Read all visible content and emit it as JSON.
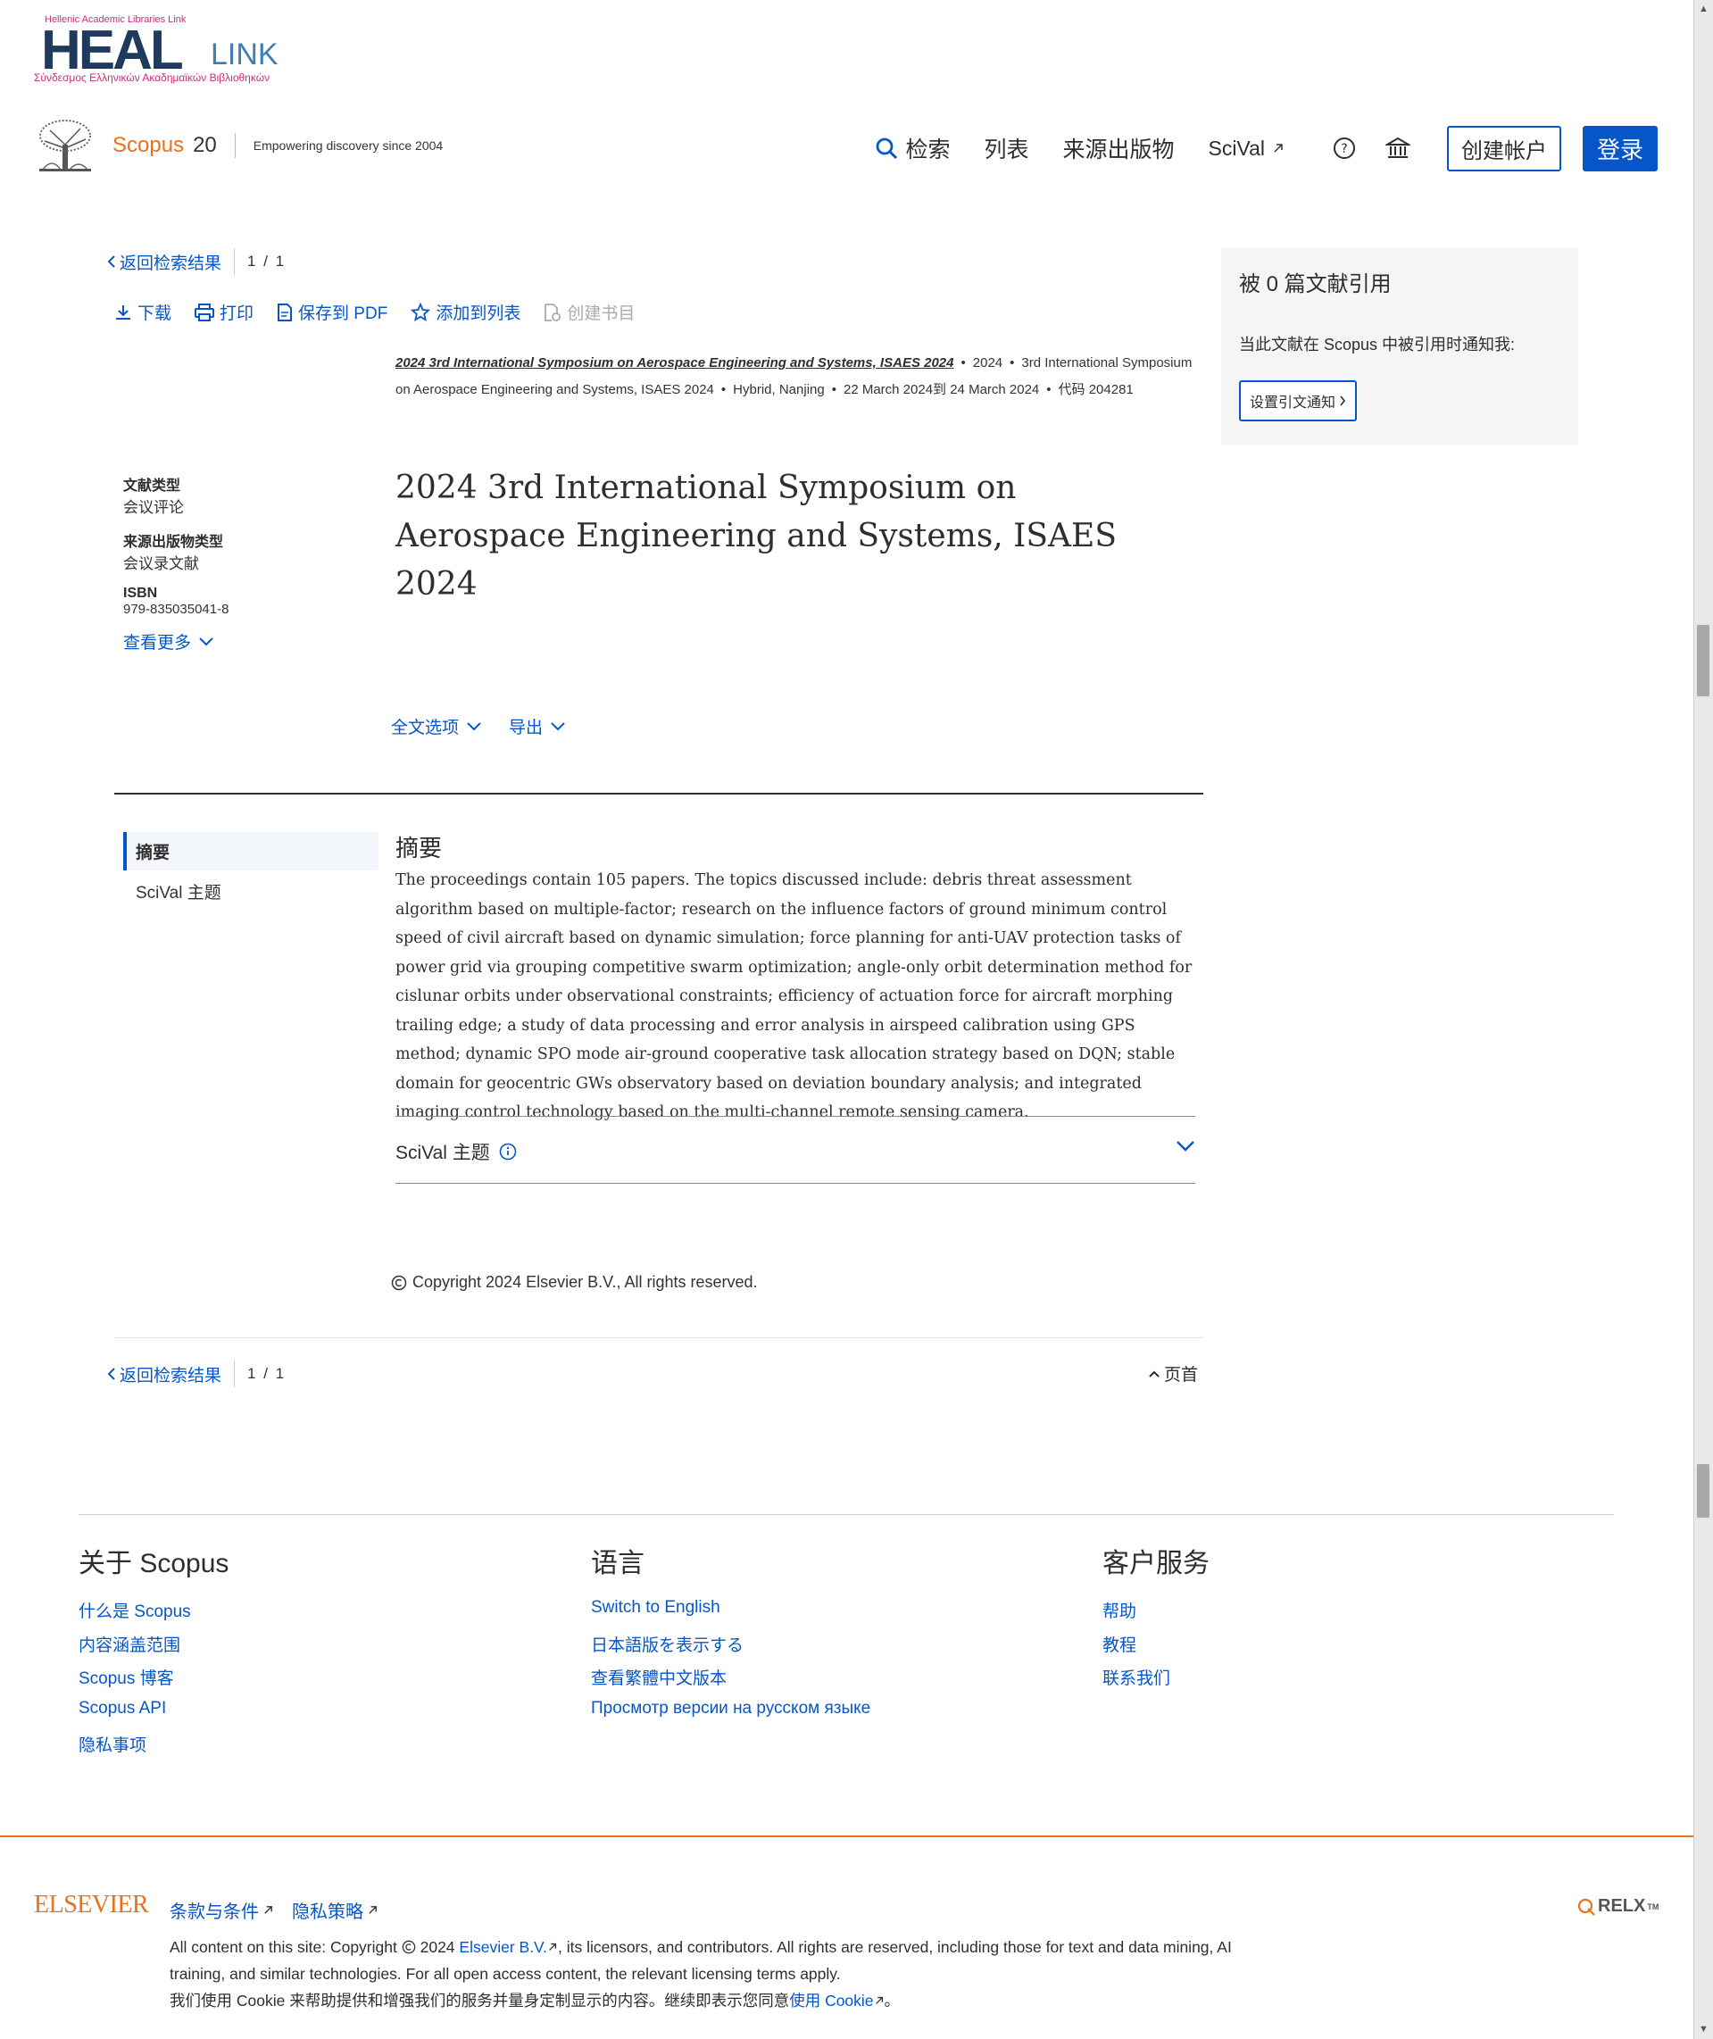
{
  "header": {
    "heal_top": "Hellenic Academic Libraries Link",
    "heal_big": "HEAL",
    "heal_link": "LINK",
    "heal_sub": "Σύνδεσμος Ελληνικών Ακαδημαϊκών Βιβλιοθηκών",
    "scopus_name": "Scopus",
    "scopus_20": "20",
    "tagline": "Empowering discovery since 2004",
    "nav": {
      "search": "检索",
      "lists": "列表",
      "sources": "来源出版物",
      "scival": "SciVal"
    },
    "create_account": "创建帐户",
    "sign_in": "登录"
  },
  "toolbar": {
    "back": "返回检索结果",
    "pager": "1 / 1",
    "download": "下载",
    "print": "打印",
    "save_pdf": "保存到 PDF",
    "add_list": "添加到列表",
    "create_bib": "创建书目"
  },
  "source": {
    "title": "2024 3rd International Symposium on Aerospace Engineering and Systems, ISAES 2024",
    "year": "2024",
    "conf": "3rd International Symposium on Aerospace Engineering and Systems, ISAES 2024",
    "location": "Hybrid, Nanjing",
    "dates": "22 March 2024到 24 March 2024",
    "code": "代码 204281"
  },
  "meta": {
    "doc_type_label": "文献类型",
    "doc_type": "会议评论",
    "source_type_label": "来源出版物类型",
    "source_type": "会议录文献",
    "isbn_label": "ISBN",
    "isbn": "979-835035041-8",
    "see_more": "查看更多"
  },
  "doc_title": "2024 3rd International Symposium on Aerospace Engineering and Systems, ISAES 2024",
  "options": {
    "full_text": "全文选项",
    "export": "导出"
  },
  "side_nav": {
    "abstract": "摘要",
    "scival_topics": "SciVal 主题"
  },
  "abstract": {
    "heading": "摘要",
    "text": "The proceedings contain 105 papers. The topics discussed include: debris threat assessment algorithm based on multiple-factor; research on the influence factors of ground minimum control speed of civil aircraft based on dynamic simulation; force planning for anti-UAV protection tasks of power grid via grouping competitive swarm optimization; angle-only orbit determination method for cislunar orbits under observational constraints; efficiency of actuation force for aircraft morphing trailing edge; a study of data processing and error analysis in airspeed calibration using GPS method; dynamic SPO mode air-ground cooperative task allocation strategy based on DQN; stable domain for geocentric GWs observatory based on deviation boundary analysis; and integrated imaging control technology based on the multi-channel remote sensing camera."
  },
  "scival_panel": {
    "label": "SciVal 主题"
  },
  "copyright": "Copyright 2024 Elsevier B.V., All rights reserved.",
  "bottom": {
    "back": "返回检索结果",
    "pager": "1 / 1",
    "top": "页首"
  },
  "citation": {
    "title": "被 0 篇文献引用",
    "text": "当此文献在 Scopus 中被引用时通知我:",
    "button": "设置引文通知"
  },
  "footer": {
    "about": {
      "heading": "关于 Scopus",
      "links": [
        "什么是 Scopus",
        "内容涵盖范围",
        "Scopus 博客",
        "Scopus API",
        "隐私事项"
      ]
    },
    "language": {
      "heading": "语言",
      "links": [
        "Switch to English",
        "日本語版を表示する",
        "查看繁體中文版本",
        "Просмотр версии на русском языке"
      ]
    },
    "support": {
      "heading": "客户服务",
      "links": [
        "帮助",
        "教程",
        "联系我们"
      ]
    }
  },
  "legal": {
    "elsevier": "ELSEVIER",
    "terms": "条款与条件",
    "privacy": "隐私策略",
    "relx": "RELX",
    "line1_a": "All content on this site: Copyright",
    "line1_b": "2024",
    "elsevier_bv": "Elsevier B.V.",
    "line1_c": ", its licensors, and contributors. All rights are reserved, including those for text and data mining, AI training, and similar technologies. For all open access content, the relevant licensing terms apply.",
    "cookie_a": "我们使用 Cookie 来帮助提供和增强我们的服务并量身定制显示的内容。继续即表示您同意",
    "cookie_link": "使用 Cookie",
    "cookie_end": "。"
  },
  "colors": {
    "brand_blue": "#0656c9",
    "scopus_orange": "#e9711c"
  }
}
